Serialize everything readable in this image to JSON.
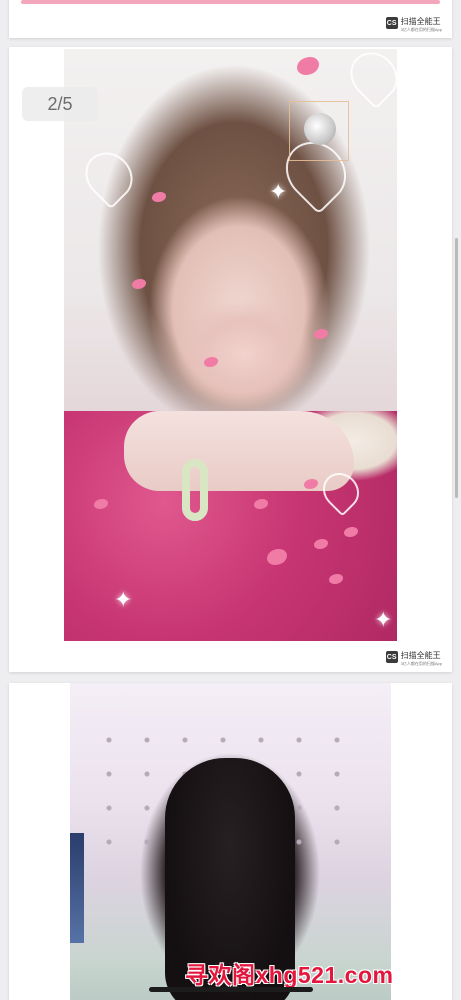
{
  "document": {
    "page_indicator": "2/5",
    "watermark": {
      "logo": "CS",
      "name": "扫描全能王",
      "tagline": "3亿人都在用的扫描App"
    }
  },
  "overlay": {
    "site_text": "寻欢阁xhg521.com"
  },
  "colors": {
    "background": "#eeeef0",
    "overlay_text": "#e3163d",
    "pink_strip": "#f4a6bd"
  },
  "icons": [
    "cs-logo-icon",
    "heart-outline-icon",
    "moon-icon",
    "sparkle-icon"
  ]
}
